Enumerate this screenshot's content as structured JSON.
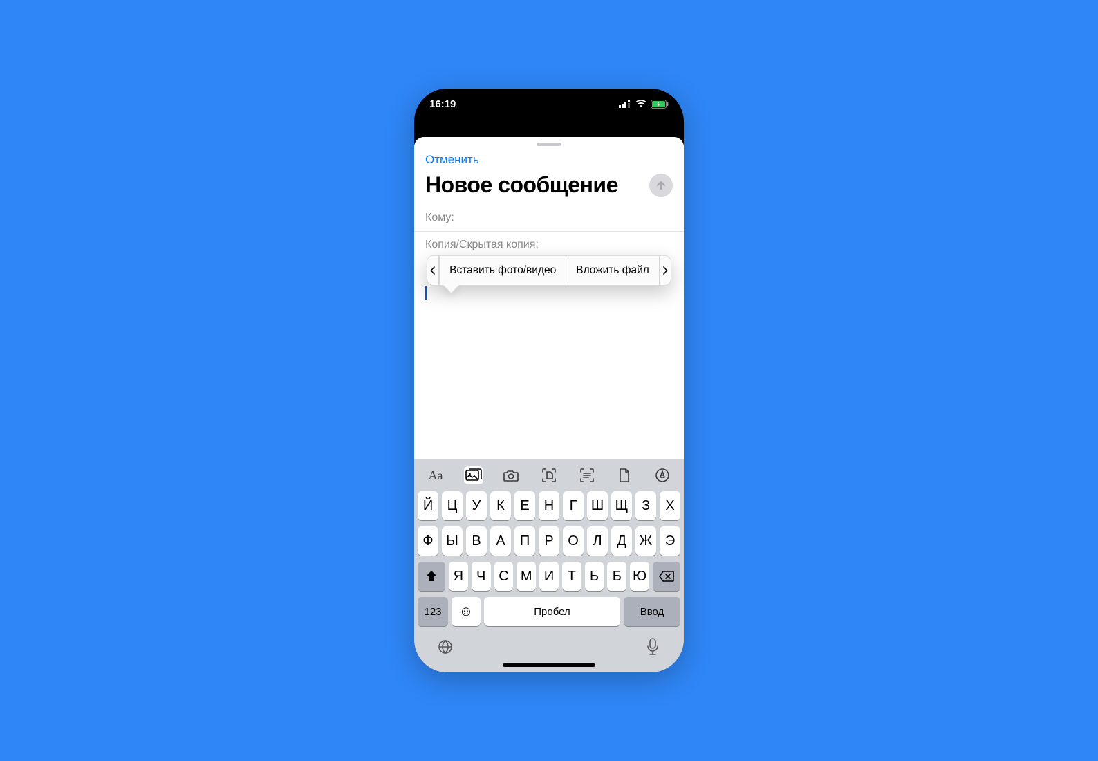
{
  "status": {
    "time": "16:19"
  },
  "header": {
    "cancel": "Отменить",
    "title": "Новое сообщение"
  },
  "fields": {
    "to_label": "Кому:",
    "cc_label": "Копия/Скрытая копия;"
  },
  "popover": {
    "item1": "Вставить фото/видео",
    "item2": "Вложить файл"
  },
  "toolbar": {
    "text_style": "Aa"
  },
  "keyboard": {
    "row1": [
      "Й",
      "Ц",
      "У",
      "К",
      "Е",
      "Н",
      "Г",
      "Ш",
      "Щ",
      "З",
      "Х"
    ],
    "row2": [
      "Ф",
      "Ы",
      "В",
      "А",
      "П",
      "Р",
      "О",
      "Л",
      "Д",
      "Ж",
      "Э"
    ],
    "row3": [
      "Я",
      "Ч",
      "С",
      "М",
      "И",
      "Т",
      "Ь",
      "Б",
      "Ю"
    ],
    "numbers": "123",
    "space": "Пробел",
    "enter": "Ввод"
  }
}
